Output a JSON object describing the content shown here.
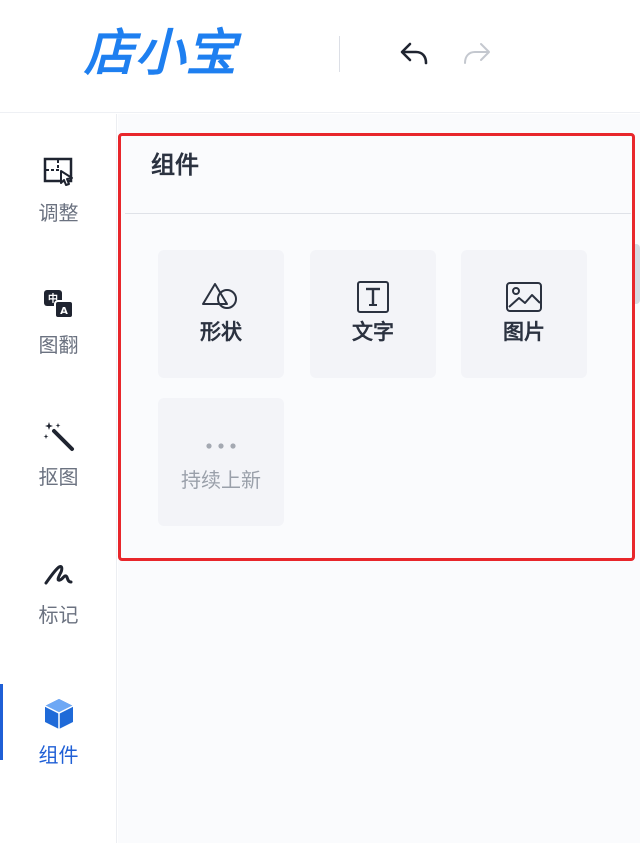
{
  "header": {
    "logo_text": "店小宝",
    "undo_icon": "undo-icon",
    "redo_icon": "redo-icon",
    "brand_color": "#1e7ff0"
  },
  "sidebar": {
    "items": [
      {
        "label": "调整",
        "icon": "adjust-icon"
      },
      {
        "label": "图翻",
        "icon": "image-translate-icon"
      },
      {
        "label": "抠图",
        "icon": "magic-wand-icon"
      },
      {
        "label": "标记",
        "icon": "signature-icon"
      },
      {
        "label": "组件",
        "icon": "cube-icon",
        "active": true
      }
    ],
    "active_color": "#1f5fd6"
  },
  "panel": {
    "title": "组件",
    "highlight_color": "#e8262b",
    "cards": [
      {
        "label": "形状",
        "icon": "shape-icon"
      },
      {
        "label": "文字",
        "icon": "text-icon"
      },
      {
        "label": "图片",
        "icon": "image-icon"
      },
      {
        "label": "持续上新",
        "icon": "more-icon"
      }
    ]
  }
}
